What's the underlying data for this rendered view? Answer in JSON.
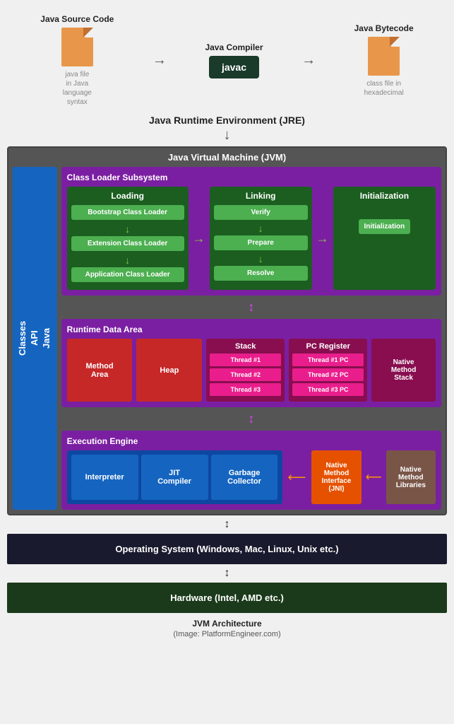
{
  "header": {
    "source_code_label": "Java Source Code",
    "source_file_subtitle": "java file\nin Java\nlanguage\nsyntax",
    "compiler_label": "Java Compiler",
    "compiler_btn": "javac",
    "bytecode_label": "Java Bytecode",
    "bytecode_subtitle": "class file in\nhexadecimal"
  },
  "jre": {
    "label": "Java Runtime Environment (JRE)"
  },
  "jvm": {
    "title": "Java Virtual Machine (JVM)",
    "api_sidebar": "Java\nAPI\nClasses"
  },
  "cls": {
    "title": "Class Loader Subsystem",
    "loading": {
      "title": "Loading",
      "bootstrap": "Bootstrap Class Loader",
      "extension": "Extension Class Loader",
      "application": "Application Class Loader"
    },
    "linking": {
      "title": "Linking",
      "verify": "Verify",
      "prepare": "Prepare",
      "resolve": "Resolve"
    },
    "initialization": {
      "title": "Initialization",
      "btn": "Initialization"
    }
  },
  "rda": {
    "title": "Runtime Data Area",
    "method_area": "Method\nArea",
    "heap": "Heap",
    "stack": {
      "title": "Stack",
      "thread1": "Thread #1",
      "thread2": "Thread #2",
      "thread3": "Thread #3"
    },
    "pc": {
      "title": "PC Register",
      "thread1": "Thread #1 PC",
      "thread2": "Thread #2 PC",
      "thread3": "Thread #3 PC"
    },
    "native_method_stack": "Native\nMethod\nStack"
  },
  "exec": {
    "title": "Execution Engine",
    "interpreter": "Interpreter",
    "jit": "JIT\nCompiler",
    "gc": "Garbage\nCollector",
    "nmi": "Native\nMethod\nInterface\n(JNI)",
    "nml": "Native\nMethod\nLibraries"
  },
  "os": {
    "label": "Operating System (Windows, Mac, Linux, Unix etc.)"
  },
  "hw": {
    "label": "Hardware (Intel, AMD etc.)"
  },
  "footer": {
    "caption": "JVM Architecture",
    "subcaption": "(Image: PlatformEngineer.com)"
  }
}
